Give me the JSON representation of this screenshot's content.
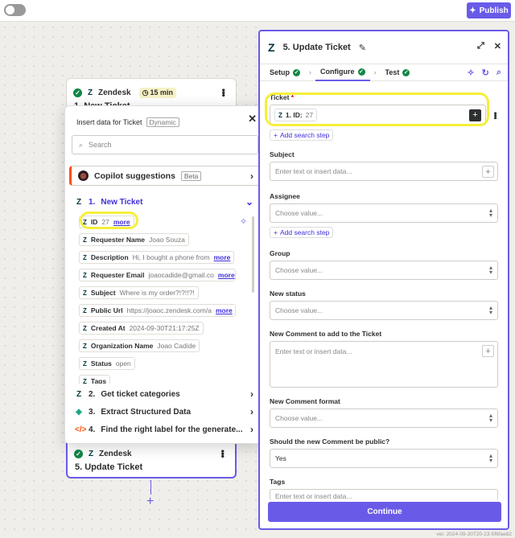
{
  "topbar": {
    "publish_label": "Publish"
  },
  "canvas": {
    "step1": {
      "app": "Zendesk",
      "time": "15 min",
      "title": "1. New Ticket"
    },
    "step5": {
      "app": "Zendesk",
      "title": "5. Update Ticket"
    }
  },
  "popup": {
    "title": "Insert data for Ticket",
    "badge": "Dynamic",
    "search_placeholder": "Search",
    "copilot": {
      "label": "Copilot suggestions",
      "badge": "Beta"
    },
    "group1": {
      "num": "1.",
      "label": "New Ticket"
    },
    "items": [
      {
        "label": "ID",
        "value": "27",
        "more": "more"
      },
      {
        "label": "Requester Name",
        "value": "Joao Souza",
        "more": ""
      },
      {
        "label": "Description",
        "value": "Hi, I bought a phone from",
        "more": "more"
      },
      {
        "label": "Requester Email",
        "value": "joaocadide@gmail.co",
        "more": "more"
      },
      {
        "label": "Subject",
        "value": "Where is my order?!?!!?!",
        "more": ""
      },
      {
        "label": "Public Url",
        "value": "https://joaoc.zendesk.com/a",
        "more": "more"
      },
      {
        "label": "Created At",
        "value": "2024-09-30T21:17:25Z",
        "more": ""
      },
      {
        "label": "Organization Name",
        "value": "Joao Cadide",
        "more": ""
      },
      {
        "label": "Status",
        "value": "open",
        "more": ""
      },
      {
        "label": "Tags",
        "value": "",
        "more": ""
      }
    ],
    "groups": [
      {
        "num": "2.",
        "label": "Get ticket categories"
      },
      {
        "num": "3.",
        "label": "Extract Structured Data"
      },
      {
        "num": "4.",
        "label": "Find the right label for the generate..."
      }
    ]
  },
  "panel": {
    "title": "5. Update Ticket",
    "tabs": [
      {
        "label": "Setup"
      },
      {
        "label": "Configure"
      },
      {
        "label": "Test"
      }
    ],
    "ticket": {
      "label": "Ticket",
      "required": "*",
      "chip_label": "1. ID:",
      "chip_value": "27"
    },
    "add_search_step": "Add search step",
    "subject": {
      "label": "Subject",
      "placeholder": "Enter text or insert data..."
    },
    "assignee": {
      "label": "Assignee",
      "placeholder": "Choose value..."
    },
    "group": {
      "label": "Group",
      "placeholder": "Choose value..."
    },
    "new_status": {
      "label": "New status",
      "placeholder": "Choose value..."
    },
    "comment": {
      "label": "New Comment to add to the Ticket",
      "placeholder": "Enter text or insert data..."
    },
    "comment_format": {
      "label": "New Comment format",
      "placeholder": "Choose value..."
    },
    "public": {
      "label": "Should the new Comment be public?",
      "value": "Yes"
    },
    "tags": {
      "label": "Tags",
      "placeholder": "Enter text or insert data..."
    },
    "continue_label": "Continue"
  },
  "version": "ver. 2024-09-30T20-23-5f6fae82"
}
